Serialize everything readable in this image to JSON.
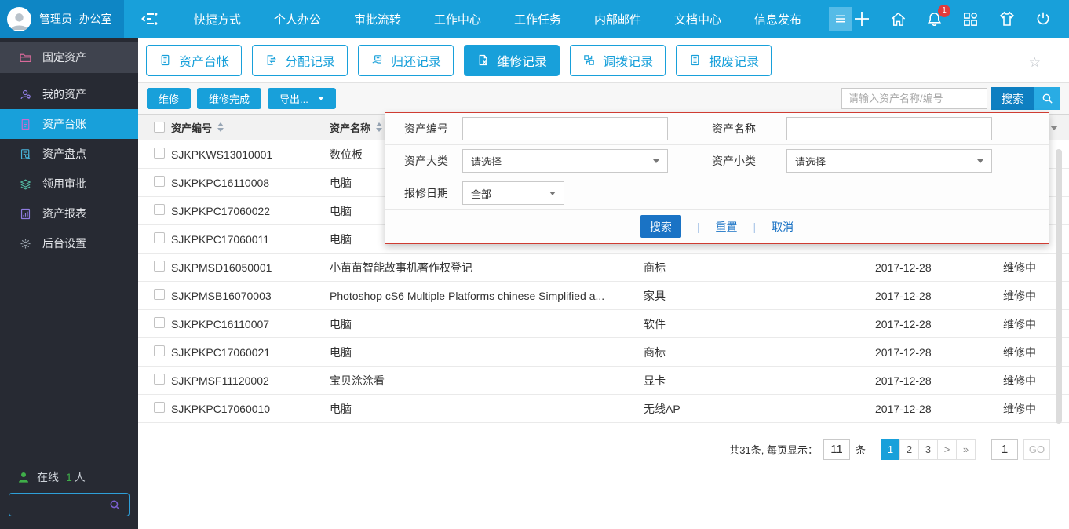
{
  "colors": {
    "accent_blue": "#18a0da",
    "topbar_left_blue": "#0e86c5",
    "sidebar_dark": "#272a33",
    "panel_border_red": "#cf3c32",
    "deep_button_blue": "#1a73c5",
    "badge_red": "#e23b3b",
    "online_green": "#3fae49"
  },
  "topbar": {
    "user": "管理员 -办公室",
    "nav": [
      "快捷方式",
      "个人办公",
      "审批流转",
      "工作中心",
      "工作任务",
      "内部邮件",
      "文档中心",
      "信息发布"
    ],
    "badge": "1"
  },
  "sidebar": {
    "items": [
      {
        "id": "fixed-assets",
        "label": "固定资产",
        "icon": "folder-icon"
      },
      {
        "id": "my-assets",
        "label": "我的资产",
        "icon": "person-icon"
      },
      {
        "id": "asset-ledger",
        "label": "资产台账",
        "icon": "ledger-icon",
        "active": true
      },
      {
        "id": "asset-inventory",
        "label": "资产盘点",
        "icon": "inventory-icon"
      },
      {
        "id": "requisition-approval",
        "label": "领用审批",
        "icon": "approval-icon"
      },
      {
        "id": "asset-reports",
        "label": "资产报表",
        "icon": "report-icon"
      },
      {
        "id": "backend-settings",
        "label": "后台设置",
        "icon": "gear-icon"
      }
    ],
    "online_label": "在线",
    "online_count": "1",
    "online_suffix": "人"
  },
  "tabs": [
    {
      "id": "asset-ledger",
      "label": "资产台帐",
      "icon": "ledger-tab-icon"
    },
    {
      "id": "allocation-records",
      "label": "分配记录",
      "icon": "assign-tab-icon"
    },
    {
      "id": "return-records",
      "label": "归还记录",
      "icon": "return-tab-icon"
    },
    {
      "id": "repair-records",
      "label": "维修记录",
      "icon": "repair-tab-icon",
      "active": true
    },
    {
      "id": "transfer-records",
      "label": "调拨记录",
      "icon": "transfer-tab-icon"
    },
    {
      "id": "scrap-records",
      "label": "报废记录",
      "icon": "scrap-tab-icon"
    }
  ],
  "icons": {
    "favorite_star": "☆"
  },
  "toolbar": {
    "repair": "维修",
    "repair_done": "维修完成",
    "export": "导出...",
    "search_placeholder": "请输入资产名称/编号",
    "search": "搜索"
  },
  "table": {
    "headers": {
      "code": "资产编号",
      "name": "资产名称"
    },
    "rows": [
      {
        "code": "SJKPKWS13010001",
        "name": "数位板",
        "category": "",
        "date": "",
        "status": ""
      },
      {
        "code": "SJKPKPC16110008",
        "name": "电脑",
        "category": "",
        "date": "",
        "status": ""
      },
      {
        "code": "SJKPKPC17060022",
        "name": "电脑",
        "category": "",
        "date": "",
        "status": ""
      },
      {
        "code": "SJKPKPC17060011",
        "name": "电脑",
        "category": "",
        "date": "",
        "status": ""
      },
      {
        "code": "SJKPMSD16050001",
        "name": "小苗苗智能故事机著作权登记",
        "category": "商标",
        "date": "2017-12-28",
        "status": "维修中"
      },
      {
        "code": "SJKPMSB16070003",
        "name": "Photoshop cS6 Multiple Platforms chinese Simplified a...",
        "category": "家具",
        "date": "2017-12-28",
        "status": "维修中"
      },
      {
        "code": "SJKPKPC16110007",
        "name": "电脑",
        "category": "软件",
        "date": "2017-12-28",
        "status": "维修中"
      },
      {
        "code": "SJKPKPC17060021",
        "name": "电脑",
        "category": "商标",
        "date": "2017-12-28",
        "status": "维修中"
      },
      {
        "code": "SJKPMSF11120002",
        "name": "宝贝涂涂看",
        "category": "显卡",
        "date": "2017-12-28",
        "status": "维修中"
      },
      {
        "code": "SJKPKPC17060010",
        "name": "电脑",
        "category": "无线AP",
        "date": "2017-12-28",
        "status": "维修中"
      }
    ]
  },
  "filter_panel": {
    "code_label": "资产编号",
    "name_label": "资产名称",
    "cat_label": "资产大类",
    "subcat_label": "资产小类",
    "date_label": "报修日期",
    "select_placeholder": "请选择",
    "date_value": "全部",
    "search": "搜索",
    "reset": "重置",
    "cancel": "取消",
    "divider": "|"
  },
  "pagination": {
    "total_text": "共31条, 每页显示：",
    "page_size": "11",
    "unit": "条",
    "pages": [
      "1",
      "2",
      "3"
    ],
    "current": "1",
    "next": ">",
    "last": "»",
    "jump_value": "1",
    "go_label": "GO"
  }
}
